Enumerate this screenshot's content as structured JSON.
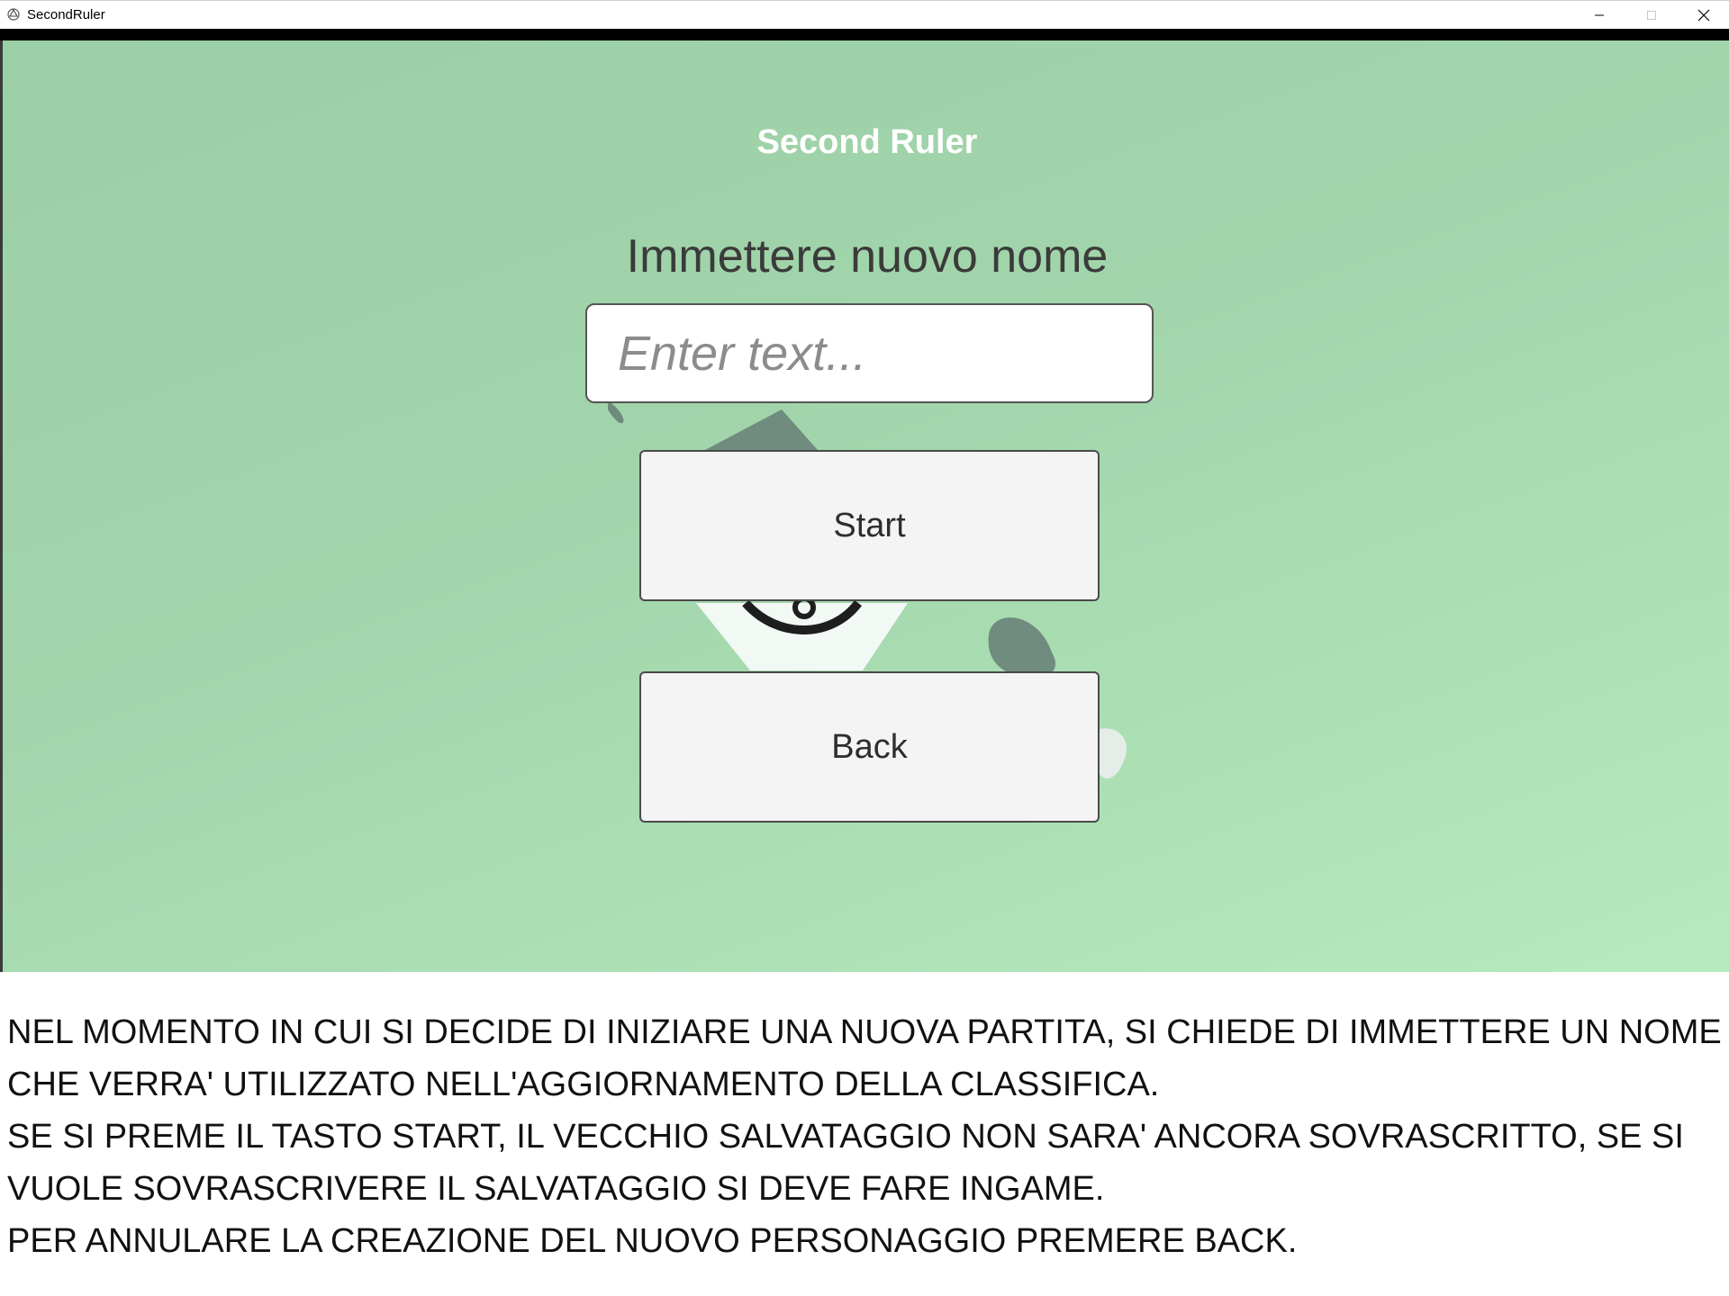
{
  "window": {
    "title": "SecondRuler",
    "icons": {
      "app": "unity-app-icon",
      "minimize": "minimize-icon",
      "maximize": "maximize-icon",
      "close": "close-icon"
    }
  },
  "game": {
    "title": "Second Ruler",
    "prompt_label": "Immettere nuovo nome",
    "name_input": {
      "value": "",
      "placeholder": "Enter text..."
    },
    "buttons": {
      "start_label": "Start",
      "back_label": "Back"
    },
    "colors": {
      "background_top": "#9bcfa5",
      "background_bottom": "#b5ebbd",
      "title": "#ffffff",
      "button_fill": "#f4f4f4"
    }
  },
  "caption": {
    "paragraphs": [
      "NEL MOMENTO IN CUI SI DECIDE DI INIZIARE UNA NUOVA PARTITA, SI CHIEDE DI IMMETTERE UN NOME CHE VERRA' UTILIZZATO NELL'AGGIORNAMENTO DELLA CLASSIFICA.",
      "SE SI PREME IL TASTO START, IL VECCHIO SALVATAGGIO NON SARA' ANCORA SOVRASCRITTO, SE SI VUOLE SOVRASCRIVERE IL SALVATAGGIO SI DEVE FARE INGAME.",
      "PER ANNULARE LA CREAZIONE DEL NUOVO PERSONAGGIO PREMERE BACK."
    ]
  }
}
